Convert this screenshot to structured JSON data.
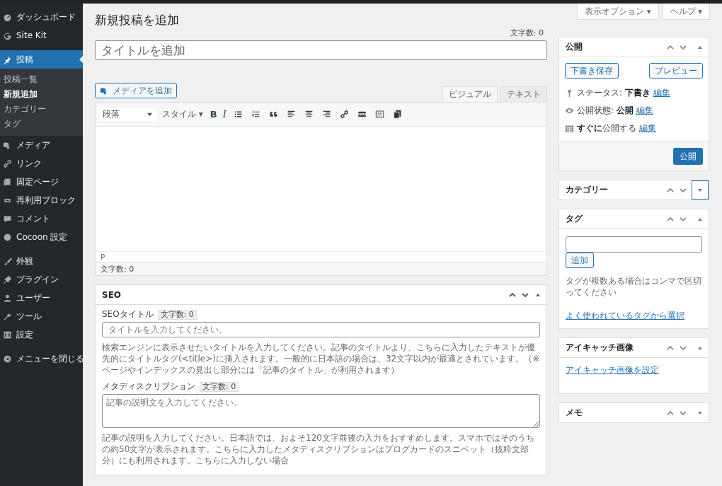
{
  "menu_groups": [
    [
      {
        "label": "ダッシュボード",
        "selected": false
      },
      {
        "label": "Site Kit",
        "selected": false
      }
    ],
    [
      {
        "label": "投稿",
        "selected": true,
        "children": [
          {
            "label": "投稿一覧",
            "selected": false
          },
          {
            "label": "新規追加",
            "selected": true
          },
          {
            "label": "カテゴリー",
            "selected": false
          },
          {
            "label": "タグ",
            "selected": false
          }
        ]
      },
      {
        "label": "メディア",
        "selected": false
      },
      {
        "label": "リンク",
        "selected": false
      },
      {
        "label": "固定ページ",
        "selected": false
      },
      {
        "label": "再利用ブロック",
        "selected": false
      },
      {
        "label": "コメント",
        "selected": false
      },
      {
        "label": "Cocoon 設定",
        "selected": false
      }
    ],
    [
      {
        "label": "外観",
        "selected": false
      },
      {
        "label": "プラグイン",
        "selected": false
      },
      {
        "label": "ユーザー",
        "selected": false
      },
      {
        "label": "ツール",
        "selected": false
      },
      {
        "label": "設定",
        "selected": false
      }
    ],
    [
      {
        "label": "メニューを閉じる",
        "selected": false
      }
    ]
  ],
  "top_buttons": [
    "表示オプション ▾",
    "ヘルプ ▾"
  ],
  "page_title": "新規投稿を追加",
  "title_count": "文字数: 0",
  "title_placeholder": "タイトルを追加",
  "media_button": "メディアを追加",
  "editor_tabs": [
    {
      "label": "ビジュアル",
      "selected": true
    },
    {
      "label": "テキスト",
      "selected": false
    }
  ],
  "format_select": "段落",
  "style_menu": "スタイル ▾",
  "bold_label": "B",
  "italic_label": "I",
  "path": "p",
  "word_count": "文字数: 0",
  "seo": {
    "title": "SEO",
    "fields": [
      {
        "kind": "input",
        "label": "SEOタイトル",
        "count": "文字数: 0",
        "placeholder": "タイトルを入力してください。",
        "help": "検索エンジンに表示させたいタイトルを入力してください。記事のタイトルより、こちらに入力したテキストが優先的にタイトルタグ(<title>)に挿入されます。一般的に日本語の場合は、32文字以内が最適とされています。（※ページやインデックスの見出し部分には「記事のタイトル」が利用されます）"
      },
      {
        "kind": "textarea",
        "label": "メタディスクリプション",
        "count": "文字数: 0",
        "placeholder": "記事の説明文を入力してください。",
        "help": "記事の説明を入力してください。日本語では、およそ120文字前後の入力をおすすめします。スマホではそのうちの約50文字が表示されます。こちらに入力したメタディスクリプションはブログカードのスニペット（抜粋文部分）にも利用されます。こちらに入力しない場合"
      }
    ]
  },
  "boxes": [
    {
      "kind": "publish",
      "title": "公開",
      "collapsed": false,
      "focused": false,
      "save_draft": "下書き保存",
      "preview": "プレビュー",
      "rows": [
        {
          "kind": "status",
          "label": "ステータス: ",
          "value": "下書き",
          "link": "編集"
        },
        {
          "kind": "visibility",
          "label": "公開状態: ",
          "value": "公開",
          "link": "編集"
        },
        {
          "kind": "schedule",
          "label": "公開する",
          "value": "すぐに",
          "link": "編集"
        }
      ],
      "publish": "公開"
    },
    {
      "kind": "category",
      "title": "カテゴリー",
      "collapsed": true,
      "focused": true
    },
    {
      "kind": "tags",
      "title": "タグ",
      "collapsed": false,
      "focused": false,
      "add": "追加",
      "hint": "タグが複数ある場合はコンマで区切ってください",
      "link": "よく使われているタグから選択"
    },
    {
      "kind": "featured",
      "title": "アイキャッチ画像",
      "collapsed": false,
      "focused": false,
      "link": "アイキャッチ画像を設定"
    },
    {
      "kind": "memo",
      "title": "メモ",
      "collapsed": true,
      "focused": false
    }
  ]
}
